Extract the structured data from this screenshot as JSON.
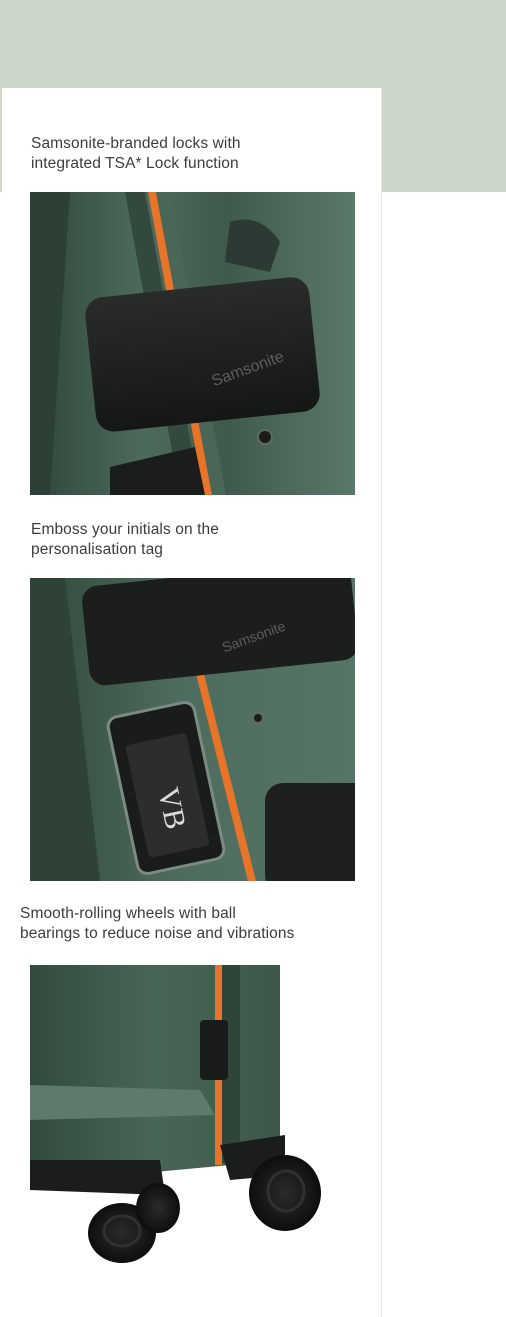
{
  "features": [
    {
      "caption_line1": "Samsonite-branded locks with",
      "caption_line2": "integrated TSA* Lock function",
      "image_icon": "lock-closeup-icon",
      "brand_text": "Samsonite"
    },
    {
      "caption_line1": "Emboss your initials on the",
      "caption_line2": "personalisation tag",
      "image_icon": "name-tag-icon",
      "brand_text": "Samsonite",
      "tag_initials": "VB"
    },
    {
      "caption_line1": "Smooth-rolling wheels with ball",
      "caption_line2": "bearings to reduce noise and vibrations",
      "image_icon": "wheels-icon"
    }
  ],
  "colors": {
    "band": "#ccd7c9",
    "shell": "#3f5a4c",
    "stripe": "#e8742a",
    "lock": "#1d1f1e"
  }
}
